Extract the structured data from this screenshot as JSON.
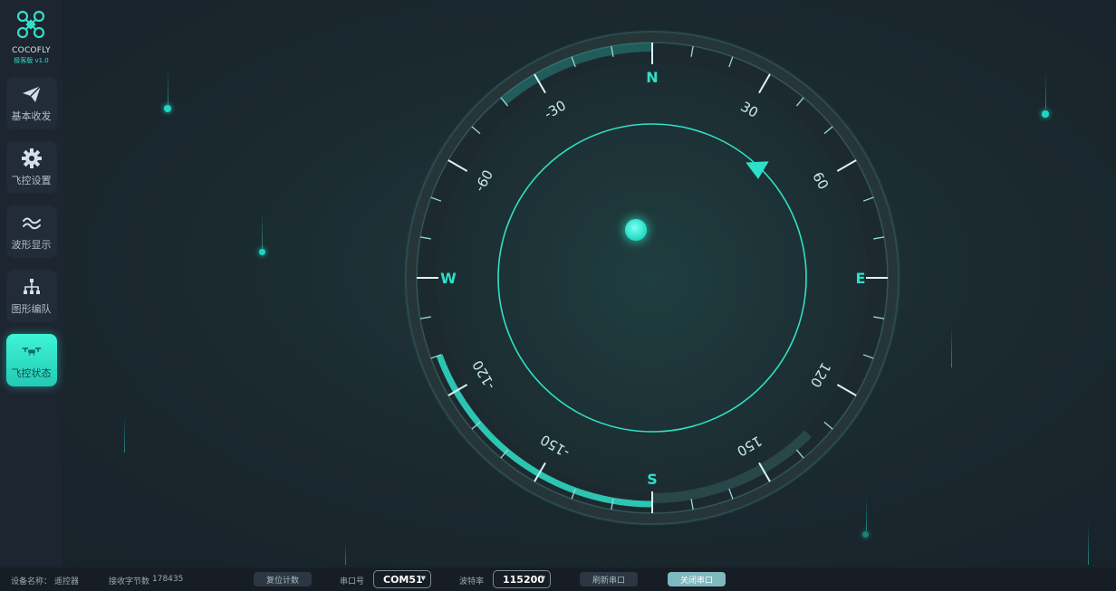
{
  "brand": {
    "name": "COCOFLY",
    "version": "极客版 v1.0"
  },
  "nav": [
    {
      "label": "基本收发",
      "icon": "send-icon",
      "active": false
    },
    {
      "label": "飞控设置",
      "icon": "gear-icon",
      "active": false
    },
    {
      "label": "波形显示",
      "icon": "wave-icon",
      "active": false
    },
    {
      "label": "图形编队",
      "icon": "hierarchy-icon",
      "active": false
    },
    {
      "label": "飞控状态",
      "icon": "drone-icon",
      "active": true
    }
  ],
  "compass": {
    "cardinals": {
      "n": "N",
      "e": "E",
      "s": "S",
      "w": "W"
    },
    "degree_labels": [
      "30",
      "60",
      "120",
      "150",
      "-150",
      "-120",
      "-60",
      "-30"
    ],
    "heading_deg": 45,
    "accent": "#2fe0c8"
  },
  "status": {
    "device_label": "设备名称：",
    "device_value": "遥控器",
    "bytes_label": "接收字节数",
    "bytes_value": "178435",
    "reset_button": "复位计数",
    "port_label": "串口号",
    "port_value": "COM51",
    "baud_label": "波特率",
    "baud_value": "115200",
    "refresh_button": "刷新串口",
    "close_button": "关闭串口"
  }
}
